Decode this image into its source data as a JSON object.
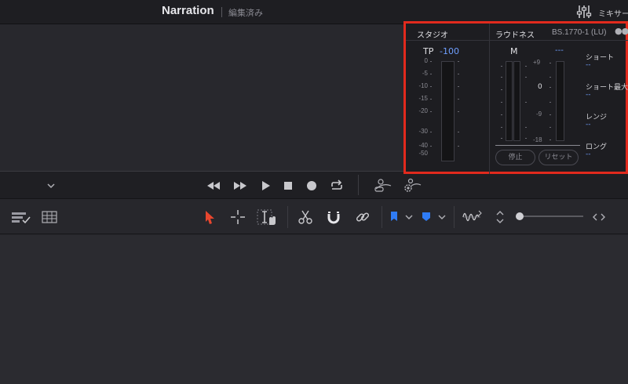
{
  "header": {
    "title": "Narration",
    "subtitle": "編集済み",
    "mixer_label": "ミキサー"
  },
  "meters": {
    "studio": {
      "title": "スタジオ",
      "tp_label": "TP",
      "tp_value": "-100",
      "scale": [
        "0",
        "-5",
        "-10",
        "-15",
        "-20",
        "-30",
        "-40",
        "-50"
      ]
    },
    "loudness": {
      "title": "ラウドネス",
      "standard": "BS.1770-1 (LU)",
      "m_label": "M",
      "top_value": "---",
      "scale": [
        "+9",
        "0",
        "-9",
        "-18"
      ],
      "stop_button": "停止",
      "reset_button": "リセット",
      "stats": [
        {
          "label": "ショート",
          "value": "--"
        },
        {
          "label": "ショート最大",
          "value": "--"
        },
        {
          "label": "レンジ",
          "value": "--"
        },
        {
          "label": "ロング",
          "value": "--"
        }
      ]
    }
  },
  "colors": {
    "accent_blue": "#6f9fff",
    "highlight_red": "#e12a1d",
    "selection_tool_red": "#e8462e",
    "flag_blue": "#2f7cf6"
  },
  "icons": {
    "transport": [
      "rewind-icon",
      "fast-forward-icon",
      "play-icon",
      "stop-icon",
      "record-icon",
      "loop-icon",
      "playhead-audio-icon",
      "playhead-settings-icon"
    ],
    "toolbar": [
      "timeline-view-options-icon",
      "grid-icon",
      "selection-arrow-icon",
      "trim-icon",
      "dynamic-trim-icon",
      "blade-icon",
      "snap-magnet-icon",
      "link-icon",
      "flag-icon",
      "marker-icon",
      "audio-waveform-icon",
      "zoom-height-icon",
      "zoom-width-icon"
    ]
  }
}
